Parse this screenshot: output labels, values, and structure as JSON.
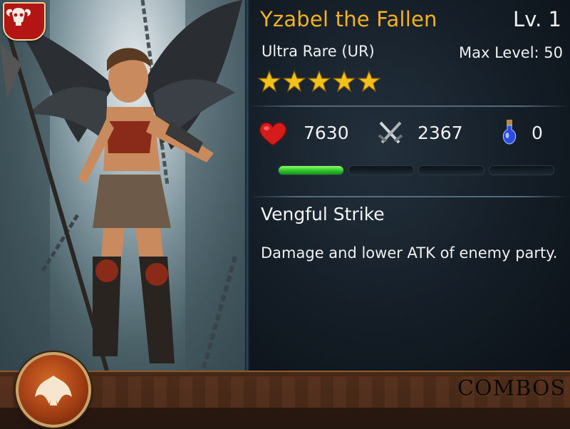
{
  "card": {
    "name": "Yzabel the Fallen",
    "level": "Lv. 1",
    "rarity": "Ultra Rare (UR)",
    "max_level": "Max Level: 50",
    "stars": 5,
    "stats": {
      "hp": "7630",
      "atk": "2367",
      "potion": "0"
    },
    "exp_progress": 0.25,
    "skill": {
      "name": "Vengful Strike",
      "description": "Damage and lower ATK of enemy party."
    }
  },
  "bottom_bar": {
    "combos_label": "COMBOS"
  },
  "colors": {
    "name": "#f5b21e",
    "exp_bar": "#2ec22a",
    "emblem": "#b31414"
  },
  "icons": {
    "faction": "ram-skull-icon",
    "hp": "heart-icon",
    "atk": "crossed-swords-icon",
    "potion": "potion-icon",
    "stars": "star-icon",
    "combos": "angel-wings-icon"
  }
}
